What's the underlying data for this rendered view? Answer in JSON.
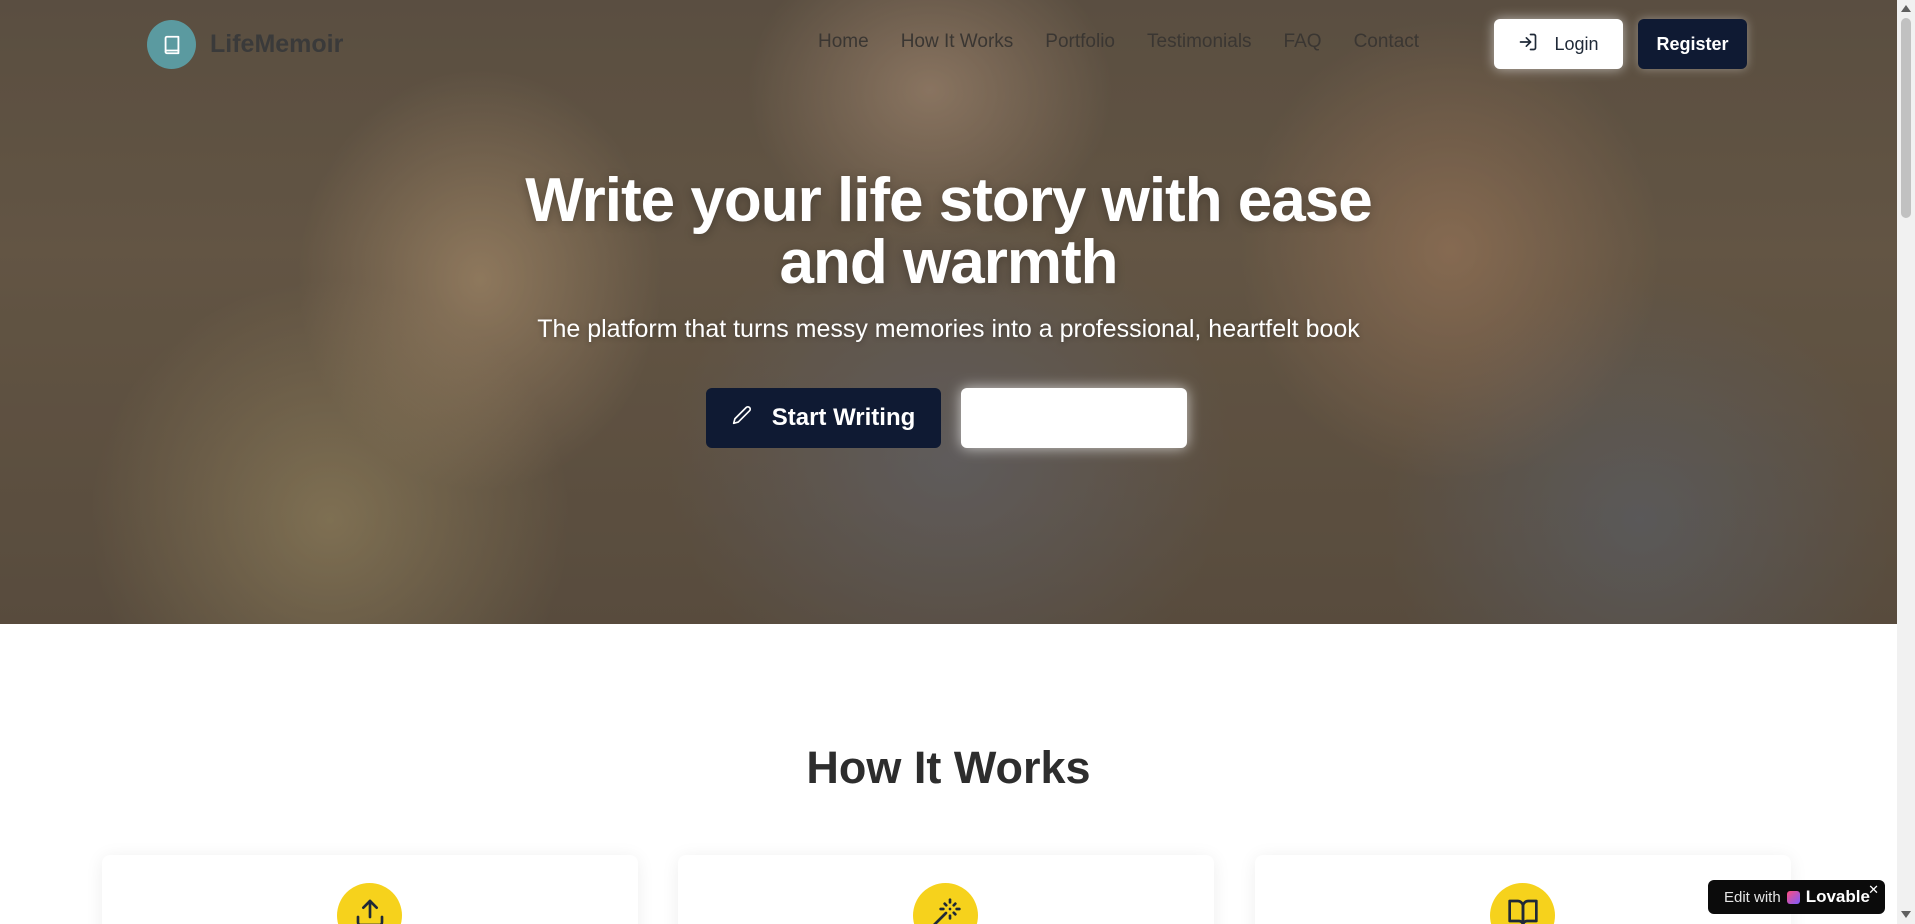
{
  "brand": {
    "name": "LifeMemoir",
    "logo_icon": "book-icon",
    "accent": "#5b9aa0"
  },
  "nav": {
    "links": [
      "Home",
      "How It Works",
      "Portfolio",
      "Testimonials",
      "FAQ",
      "Contact"
    ],
    "login_label": "Login",
    "register_label": "Register"
  },
  "hero": {
    "title_line1": "Write your life story with ease",
    "title_line2": "and warmth",
    "subtitle": "The platform that turns messy memories into a professional, heartfelt book",
    "primary_cta": "Start Writing",
    "secondary_cta": ""
  },
  "how_it_works": {
    "title": "How It Works",
    "steps": [
      {
        "icon": "upload-icon"
      },
      {
        "icon": "magic-wand-icon"
      },
      {
        "icon": "open-book-icon"
      }
    ],
    "icon_color": "#f6d21c"
  },
  "colors": {
    "primary_dark": "#0f1a33",
    "heading": "#2d2d2d"
  },
  "badge": {
    "prefix": "Edit with",
    "name": "Lovable",
    "close": "✕"
  }
}
